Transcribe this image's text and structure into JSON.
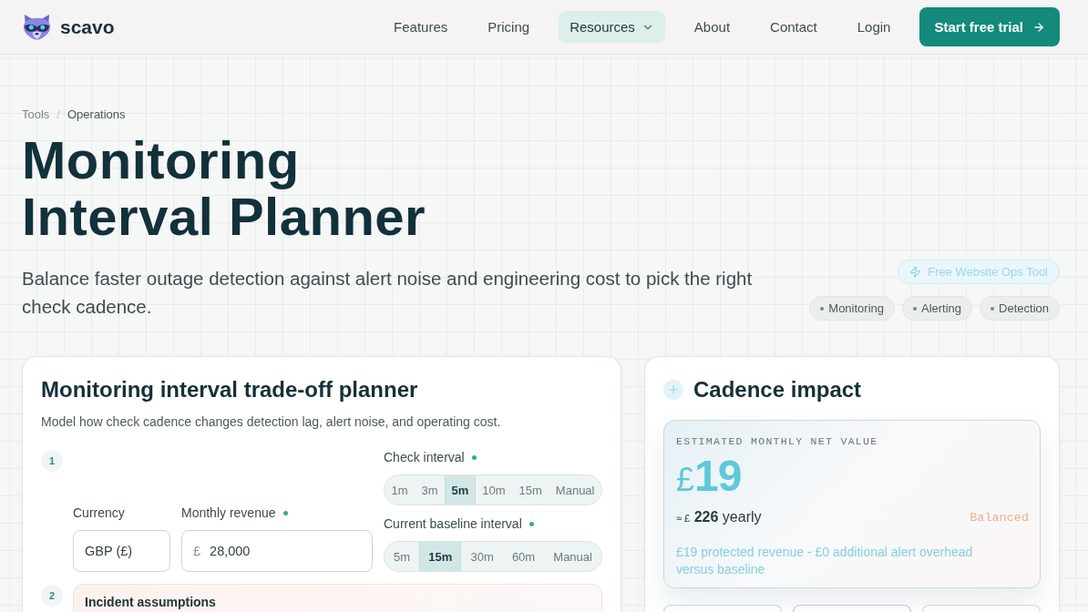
{
  "header": {
    "brand": "scavo",
    "nav": [
      {
        "label": "Features",
        "kind": "link",
        "selected": false
      },
      {
        "label": "Pricing",
        "kind": "link",
        "selected": false
      },
      {
        "label": "Resources",
        "kind": "dropdown",
        "selected": true
      },
      {
        "label": "About",
        "kind": "link",
        "selected": false
      },
      {
        "label": "Contact",
        "kind": "link",
        "selected": false
      },
      {
        "label": "Login",
        "kind": "link",
        "selected": false
      }
    ],
    "cta": "Start free trial"
  },
  "breadcrumb": {
    "separator": "/",
    "items": [
      {
        "label": "Tools",
        "current": false
      },
      {
        "label": "Operations",
        "current": true
      }
    ]
  },
  "hero": {
    "title": "Monitoring Interval Planner",
    "subtitle": "Balance faster outage detection against alert noise and engineering cost to pick the right check cadence.",
    "badge": "Free Website Ops Tool",
    "tags": [
      "Monitoring",
      "Alerting",
      "Detection"
    ]
  },
  "planner": {
    "title": "Monitoring interval trade-off planner",
    "description": "Model how check cadence changes detection lag, alert noise, and operating cost.",
    "steps": [
      {
        "number": "1",
        "kind": "inputs",
        "currency": {
          "label": "Currency",
          "dot": false,
          "value": "GBP (£)"
        },
        "revenue": {
          "label": "Monthly revenue",
          "dot": true,
          "prefix": "£",
          "value": "28,000"
        },
        "intervals": [
          {
            "label": "Check interval",
            "dot": true,
            "options": [
              {
                "label": "1m",
                "selected": false
              },
              {
                "label": "3m",
                "selected": false
              },
              {
                "label": "5m",
                "selected": true
              },
              {
                "label": "10m",
                "selected": false
              },
              {
                "label": "15m",
                "selected": false
              },
              {
                "label": "Manual",
                "selected": false
              }
            ]
          },
          {
            "label": "Current baseline interval",
            "dot": true,
            "options": [
              {
                "label": "5m",
                "selected": false
              },
              {
                "label": "15m",
                "selected": true
              },
              {
                "label": "30m",
                "selected": false
              },
              {
                "label": "60m",
                "selected": false
              },
              {
                "label": "Manual",
                "selected": false
              }
            ]
          }
        ]
      },
      {
        "number": "2",
        "kind": "section",
        "heading": "Incident assumptions"
      }
    ]
  },
  "impact": {
    "title": "Cadence impact",
    "summary": {
      "label": "ESTIMATED MONTHLY NET VALUE",
      "currency": "£",
      "amount": "19",
      "yearly": {
        "prefix": "≈ £",
        "amount": "226",
        "suffix": "yearly"
      },
      "status": "Balanced",
      "note": "£19 protected revenue - £0 additional alert overhead versus baseline"
    },
    "metric_cards": [
      {
        "color": "#b9d9e8"
      },
      {
        "color": "#c6bdf0"
      },
      {
        "color": "#f2cbb8"
      }
    ]
  }
}
